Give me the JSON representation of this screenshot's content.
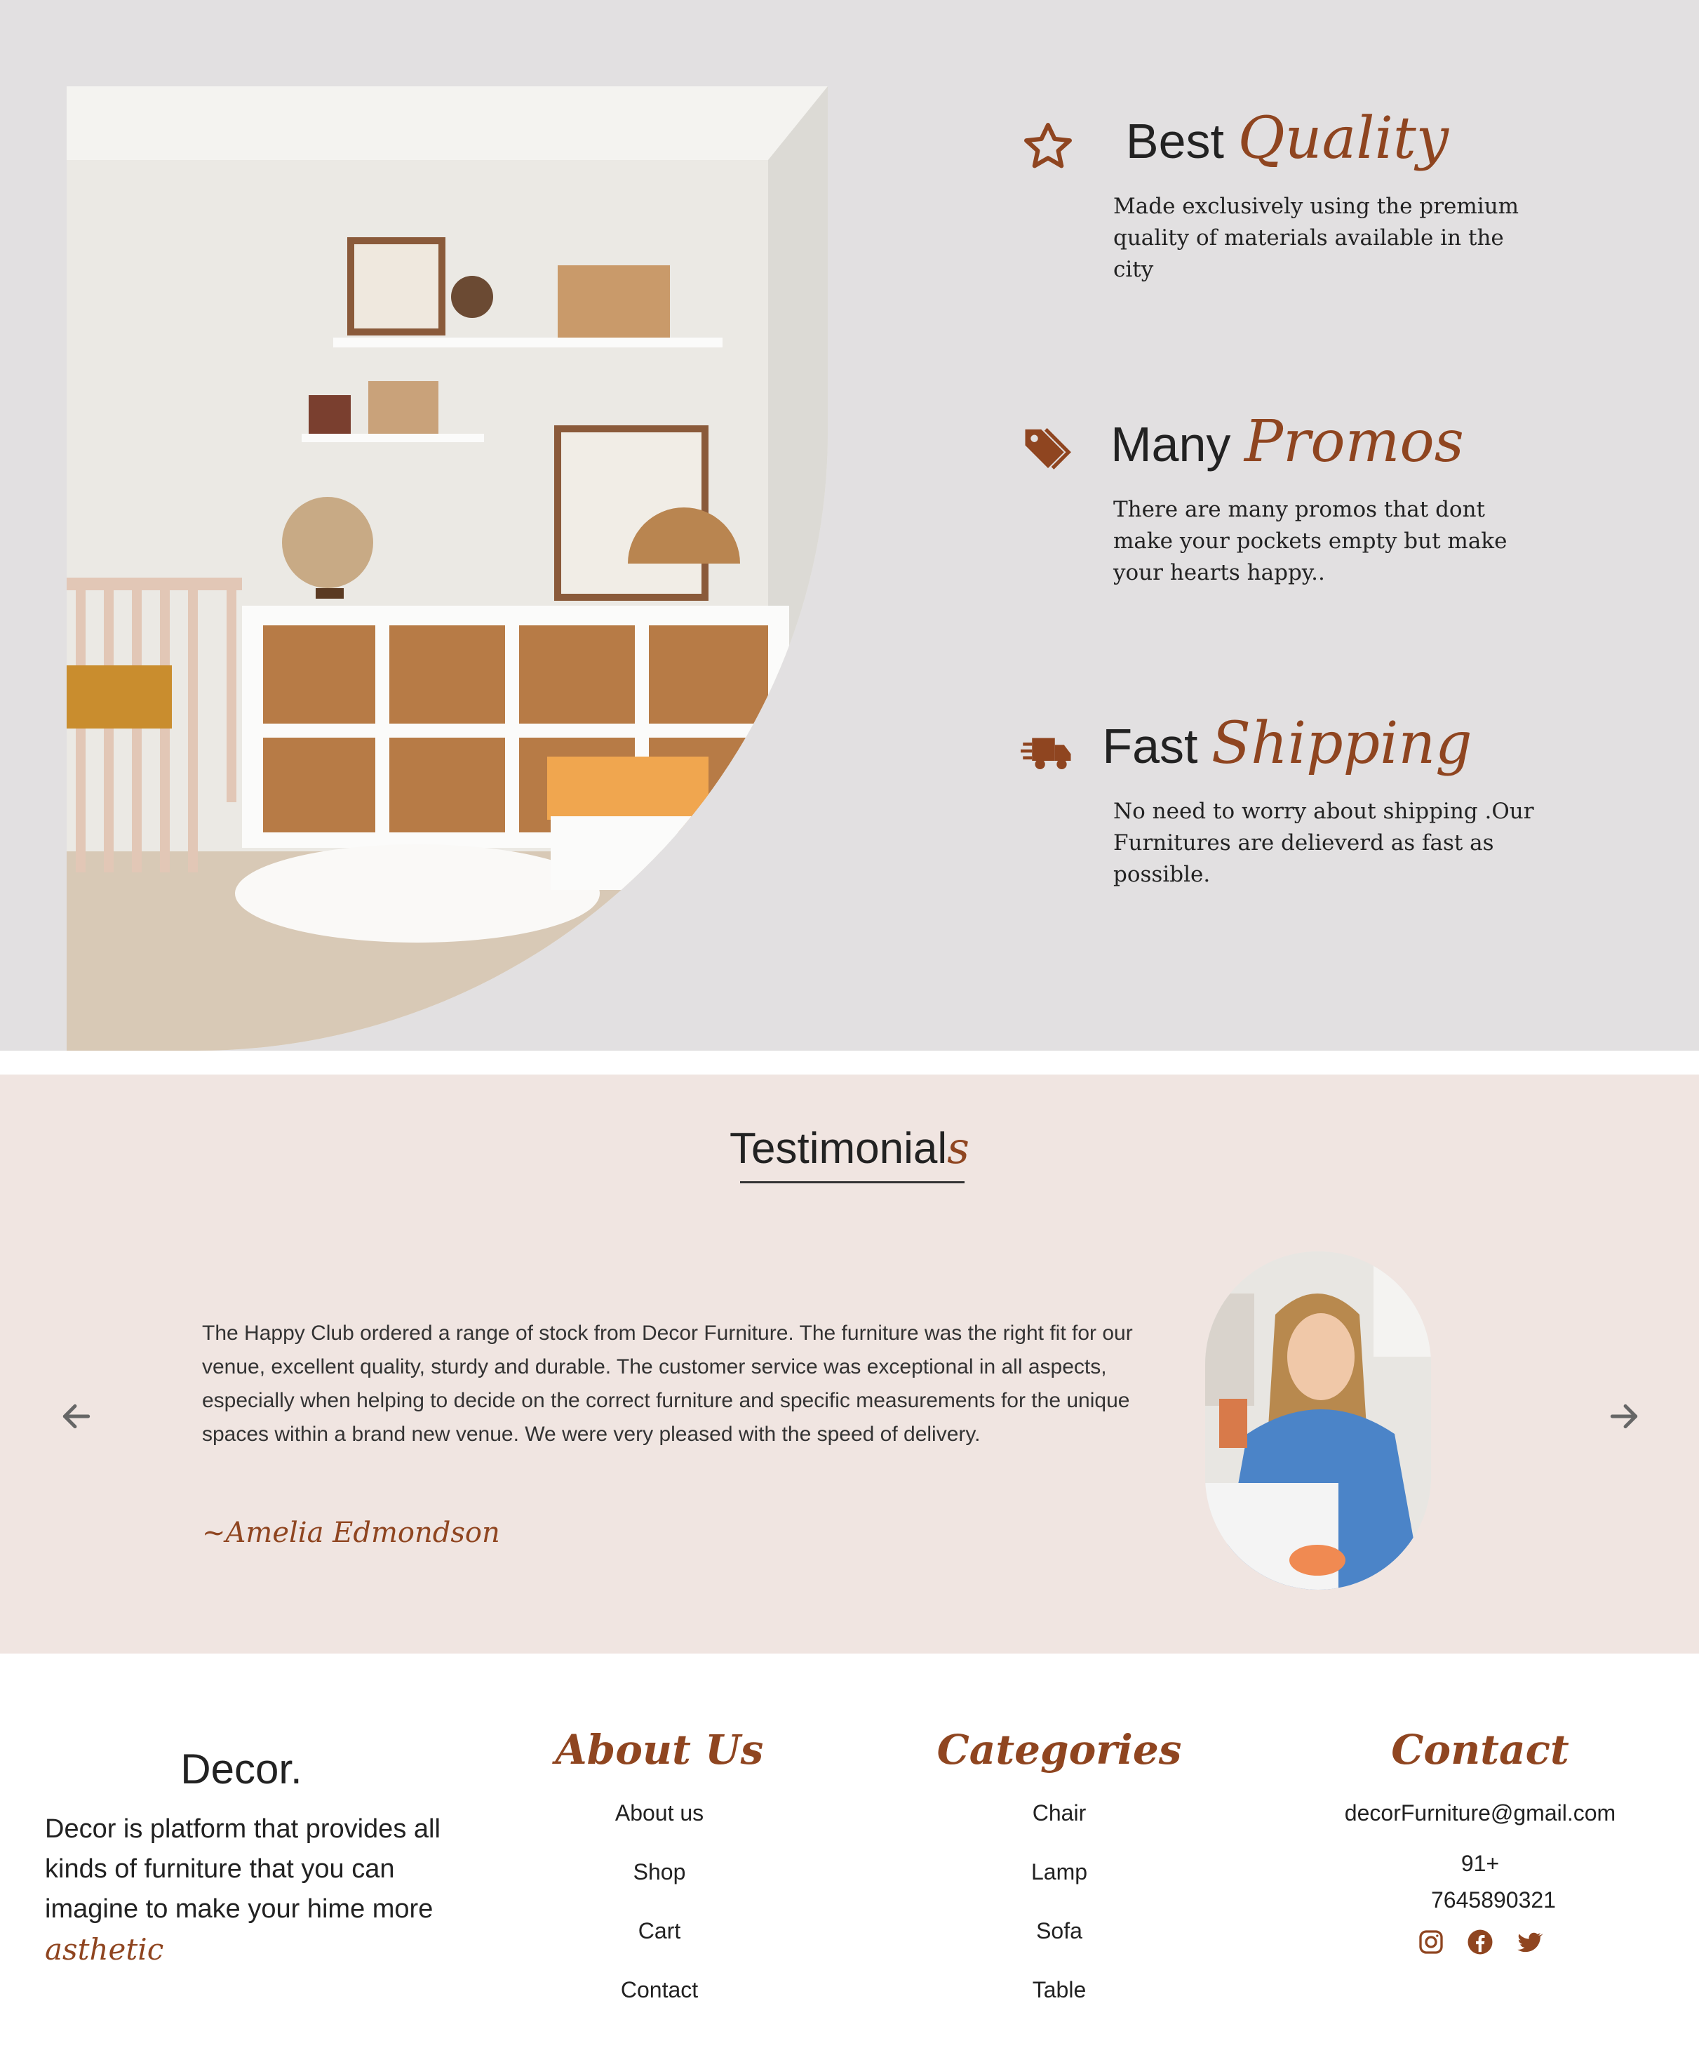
{
  "features": {
    "items": [
      {
        "icon": "star-icon",
        "title_plain": "Best",
        "title_script": "Quality",
        "desc": "Made exclusively using the premium quality of materials available in the city"
      },
      {
        "icon": "tag-icon",
        "title_plain": "Many",
        "title_script": "Promos",
        "desc": "There are many promos that dont make your pockets empty but make your hearts happy.."
      },
      {
        "icon": "truck-icon",
        "title_plain": "Fast",
        "title_script": "Shipping",
        "desc": "No need to worry about shipping .Our Furnitures are delieverd as fast as possible."
      }
    ]
  },
  "testimonials": {
    "heading_plain": "Testimonial",
    "heading_script": "s",
    "quote": "The Happy Club ordered a range of stock from Decor Furniture. The furniture was the right fit for our venue, excellent quality, sturdy and durable. The customer service was exceptional in all aspects, especially when helping to decide on the correct furniture and specific measurements for the unique spaces within a brand new venue. We were very pleased with the speed of delivery.",
    "author": "~Amelia Edmondson"
  },
  "footer": {
    "brand": "Decor.",
    "brand_text": "Decor is platform that provides all kinds of furniture that you can imagine to make your hime more",
    "brand_script": "asthetic",
    "about": {
      "heading": "About Us",
      "items": [
        "About us",
        "Shop",
        "Cart",
        "Contact"
      ]
    },
    "categories": {
      "heading": "Categories",
      "items": [
        "Chair",
        "Lamp",
        "Sofa",
        "Table"
      ]
    },
    "contact": {
      "heading": "Contact",
      "email": "decorFurniture@gmail.com",
      "phone": "91+ 7645890321",
      "socials": [
        "instagram-icon",
        "facebook-icon",
        "twitter-icon"
      ]
    }
  },
  "colors": {
    "accent": "#8f4520",
    "features_bg": "#e2e0e1",
    "testimonials_bg": "#f0e5e1",
    "footer_bg": "#ffffff"
  }
}
